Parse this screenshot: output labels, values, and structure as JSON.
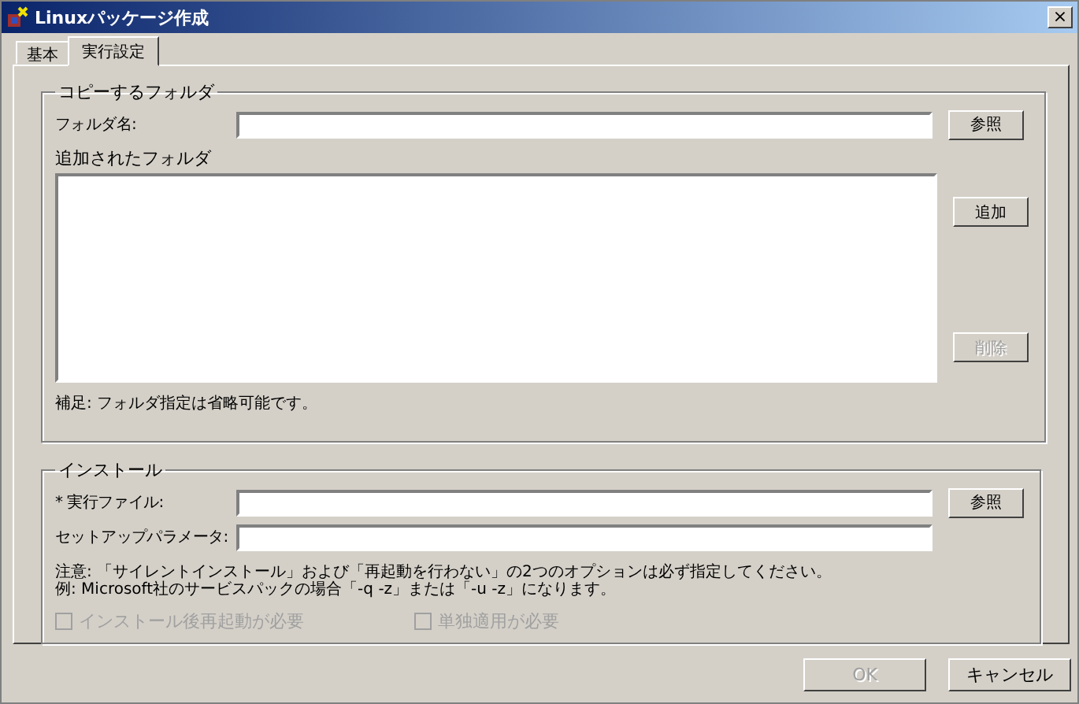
{
  "window": {
    "title": "Linuxパッケージ作成",
    "close": "×"
  },
  "tabs": [
    {
      "label": "基本",
      "selected": false
    },
    {
      "label": "実行設定",
      "selected": true
    }
  ],
  "copy_group": {
    "title": "コピーするフォルダ",
    "folder_label": "フォルダ名:",
    "browse": "参照",
    "list_label": "追加されたフォルダ",
    "add": {
      "label": "追加",
      "disabled": false
    },
    "remove": {
      "label": "削除",
      "disabled": true
    },
    "note": "補足: フォルダ指定は省略可能です。"
  },
  "install_group": {
    "title": "インストール",
    "exe_label": "* 実行ファイル:",
    "browse": "参照",
    "param_label": "セットアップパラメータ:",
    "notes": [
      "注意: 「サイレントインストール」および「再起動を行わない」の2つのオプションは必ず指定してください。",
      "例: Microsoft社のサービスパックの場合「-q -z」または「-u -z」になります。"
    ],
    "checkboxes": [
      {
        "label": "インストール後再起動が必要",
        "checked": false,
        "disabled": true
      },
      {
        "label": "単独適用が必要",
        "checked": false,
        "disabled": true
      }
    ]
  },
  "buttons": [
    {
      "label": "OK",
      "disabled": true
    },
    {
      "label": "キャンセル",
      "disabled": false
    }
  ]
}
